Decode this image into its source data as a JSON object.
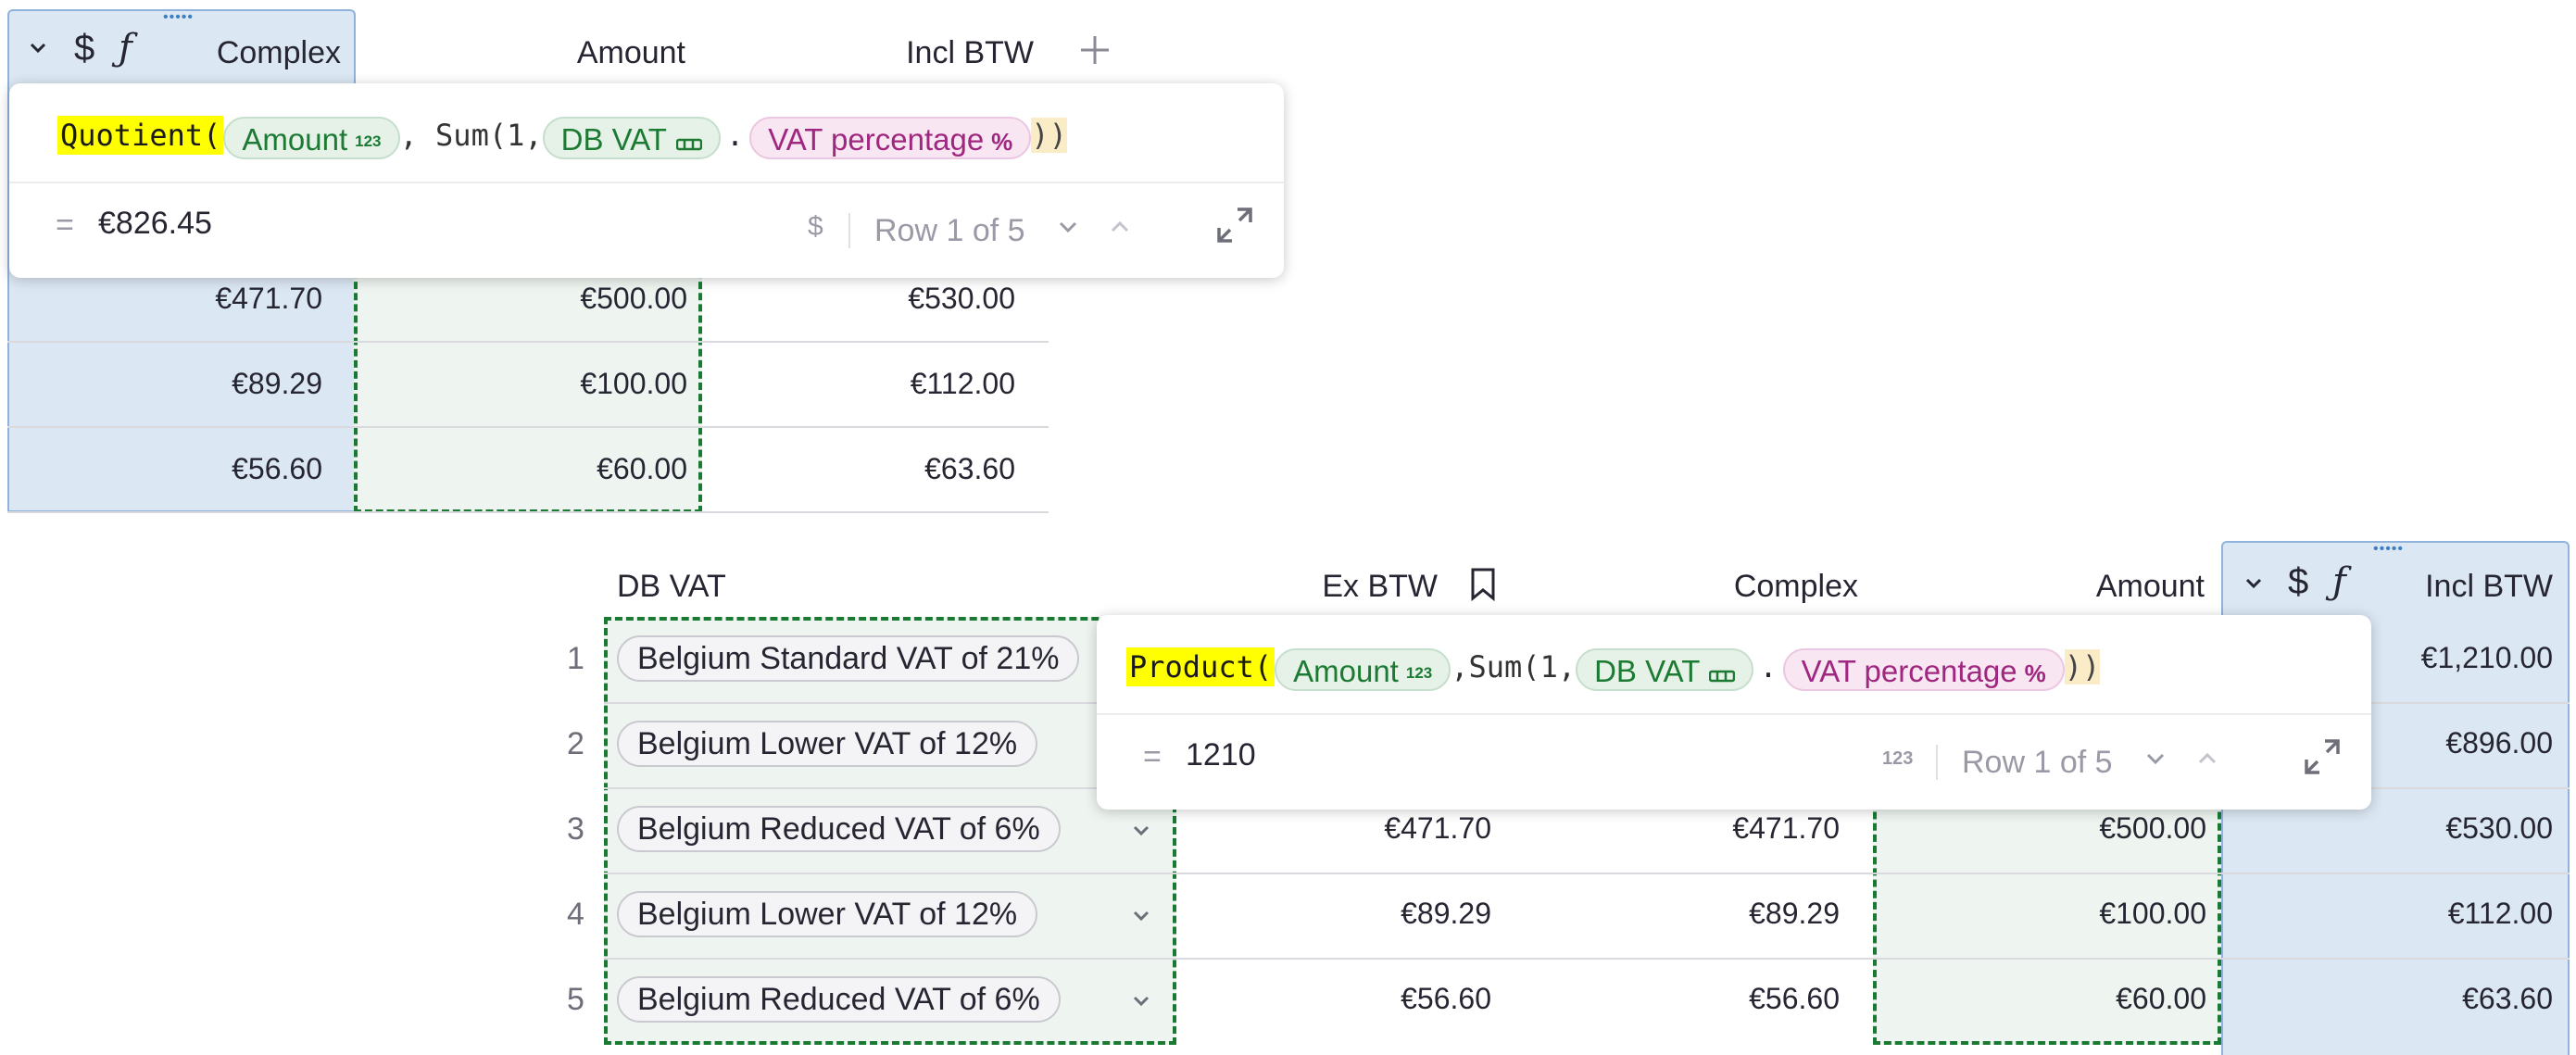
{
  "top": {
    "headers": {
      "complex": "Complex",
      "amount": "Amount",
      "incl": "Incl BTW"
    },
    "header_icons": [
      "chevron-down-icon",
      "dollar-icon",
      "function-icon",
      "drag-handle-icon",
      "plus-icon"
    ],
    "rows": [
      {
        "complex": "€471.70",
        "amount": "€500.00",
        "incl": "€530.00"
      },
      {
        "complex": "€89.29",
        "amount": "€100.00",
        "incl": "€112.00"
      },
      {
        "complex": "€56.60",
        "amount": "€60.00",
        "incl": "€63.60"
      }
    ],
    "formula": {
      "fn": "Quotient(",
      "ref1": "Amount",
      "ref1_badge": "123",
      "sep": ", Sum(1,",
      "ref2": "DB VAT",
      "dot": ".",
      "ref3": "VAT percentage",
      "ref3_badge": "%",
      "close": "))"
    },
    "result": {
      "eq": "=",
      "value": "€826.45",
      "type_icon": "$",
      "row_label": "Row 1 of 5"
    }
  },
  "bottom": {
    "headers": {
      "dbvat": "DB VAT",
      "exbtw": "Ex BTW",
      "complex": "Complex",
      "amount": "Amount",
      "incl": "Incl BTW"
    },
    "rows": [
      {
        "num": "1",
        "dbvat": "Belgium Standard VAT of 21%",
        "exbtw": "",
        "complex": "",
        "amount": "",
        "incl": "€1,210.00"
      },
      {
        "num": "2",
        "dbvat": "Belgium Lower VAT of 12%",
        "exbtw": "",
        "complex": "",
        "amount": "",
        "incl": "€896.00"
      },
      {
        "num": "3",
        "dbvat": "Belgium Reduced VAT of 6%",
        "exbtw": "€471.70",
        "complex": "€471.70",
        "amount": "€500.00",
        "incl": "€530.00"
      },
      {
        "num": "4",
        "dbvat": "Belgium Lower VAT of 12%",
        "exbtw": "€89.29",
        "complex": "€89.29",
        "amount": "€100.00",
        "incl": "€112.00"
      },
      {
        "num": "5",
        "dbvat": "Belgium Reduced VAT of 6%",
        "exbtw": "€56.60",
        "complex": "€56.60",
        "amount": "€60.00",
        "incl": "€63.60"
      }
    ],
    "formula": {
      "fn": "Product(",
      "ref1": "Amount",
      "ref1_badge": "123",
      "sep": ",Sum(1,",
      "ref2": "DB VAT",
      "dot": ".",
      "ref3": "VAT percentage",
      "ref3_badge": "%",
      "close": "))"
    },
    "result": {
      "eq": "=",
      "value": "1210",
      "type_icon": "123",
      "row_label": "Row 1 of 5"
    }
  },
  "colors": {
    "selected_column": "#dbe7f3",
    "reference_border": "#1a7a34",
    "highlight": "#ffff00"
  }
}
